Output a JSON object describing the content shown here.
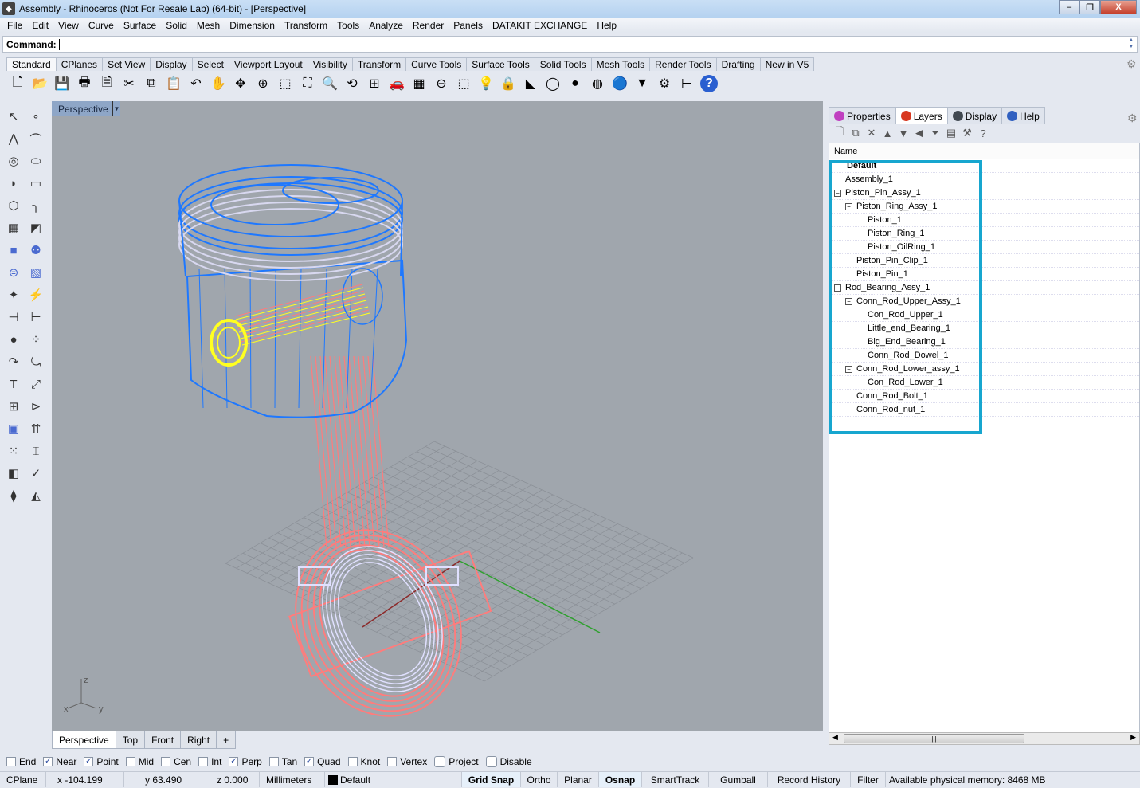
{
  "window": {
    "title": "Assembly - Rhinoceros (Not For Resale Lab) (64-bit) - [Perspective]",
    "minimize": "–",
    "restore": "❐",
    "close": "X"
  },
  "menu": [
    "File",
    "Edit",
    "View",
    "Curve",
    "Surface",
    "Solid",
    "Mesh",
    "Dimension",
    "Transform",
    "Tools",
    "Analyze",
    "Render",
    "Panels",
    "DATAKIT EXCHANGE",
    "Help"
  ],
  "command": {
    "label": "Command:",
    "value": ""
  },
  "toolbar_tabs": [
    "Standard",
    "CPlanes",
    "Set View",
    "Display",
    "Select",
    "Viewport Layout",
    "Visibility",
    "Transform",
    "Curve Tools",
    "Surface Tools",
    "Solid Tools",
    "Mesh Tools",
    "Render Tools",
    "Drafting",
    "New in V5"
  ],
  "toolbar_icons": [
    {
      "name": "new-icon",
      "glyph": "🗋"
    },
    {
      "name": "open-icon",
      "glyph": "📂"
    },
    {
      "name": "save-icon",
      "glyph": "💾"
    },
    {
      "name": "print-icon",
      "glyph": "🖶"
    },
    {
      "name": "export-icon",
      "glyph": "🗎"
    },
    {
      "name": "cut-icon",
      "glyph": "✂"
    },
    {
      "name": "copy-icon",
      "glyph": "⧉"
    },
    {
      "name": "paste-icon",
      "glyph": "📋"
    },
    {
      "name": "undo-icon",
      "glyph": "↶"
    },
    {
      "name": "pan-icon",
      "glyph": "✋"
    },
    {
      "name": "rotate-view-icon",
      "glyph": "✥"
    },
    {
      "name": "zoom-dynamic-icon",
      "glyph": "⊕"
    },
    {
      "name": "zoom-window-icon",
      "glyph": "⬚"
    },
    {
      "name": "zoom-extents-icon",
      "glyph": "⛶"
    },
    {
      "name": "zoom-selected-icon",
      "glyph": "🔍"
    },
    {
      "name": "undo-view-icon",
      "glyph": "⟲"
    },
    {
      "name": "viewport-layout-icon",
      "glyph": "⊞"
    },
    {
      "name": "car-icon",
      "glyph": "🚗"
    },
    {
      "name": "cplane-icon",
      "glyph": "▦"
    },
    {
      "name": "osnap-icon",
      "glyph": "⊖"
    },
    {
      "name": "select-points-icon",
      "glyph": "⬚"
    },
    {
      "name": "light-icon",
      "glyph": "💡"
    },
    {
      "name": "lock-icon",
      "glyph": "🔒"
    },
    {
      "name": "layer-icon",
      "glyph": "◣"
    },
    {
      "name": "color-wheel-icon",
      "glyph": "◯"
    },
    {
      "name": "shaded-sphere-icon",
      "glyph": "●"
    },
    {
      "name": "rendered-sphere-icon",
      "glyph": "◍"
    },
    {
      "name": "render-sphere-icon",
      "glyph": "🔵"
    },
    {
      "name": "cone-icon",
      "glyph": "▼"
    },
    {
      "name": "options-gear-icon",
      "glyph": "⚙"
    },
    {
      "name": "dimension-icon",
      "glyph": "⊢"
    },
    {
      "name": "help-icon",
      "glyph": "?"
    }
  ],
  "left_tools": [
    "select-arrow-icon",
    "point-icon",
    "polyline-icon",
    "curve-icon",
    "circle-icon",
    "ellipse-icon",
    "arc-icon",
    "rectangle-icon",
    "polygon-icon",
    "fillet-icon",
    "surface-points-icon",
    "sweep-icon",
    "box-icon",
    "spheres-icon",
    "cylinder-icon",
    "mesh-icon",
    "join-icon",
    "explode-icon",
    "trim-icon",
    "split-icon",
    "boolean-union-icon",
    "points-icon",
    "offset-icon",
    "offset-curve-icon",
    "text-icon",
    "scale-icon",
    "array-icon",
    "move-icon",
    "solid-box-icon",
    "extrude-icon",
    "grid-array-icon",
    "section-icon",
    "transform-icon",
    "check-icon",
    "solids-icon",
    "analyze-icon"
  ],
  "left_glyphs": [
    "↖",
    "∘",
    "⋀",
    "⌒",
    "◎",
    "⬭",
    "◗",
    "▭",
    "⬡",
    "╮",
    "▦",
    "◩",
    "■",
    "⚉",
    "⊜",
    "▧",
    "✦",
    "⚡",
    "⊣",
    "⊢",
    "●",
    "⁘",
    "↷",
    "⤿",
    "T",
    "⤢",
    "⊞",
    "⊳",
    "▣",
    "⇈",
    "⁙",
    "⌶",
    "◧",
    "✓",
    "⧫",
    "◭"
  ],
  "viewport": {
    "title": "Perspective",
    "axes": {
      "z": "z",
      "x": "x",
      "y": "y"
    },
    "tabs": [
      "Perspective",
      "Top",
      "Front",
      "Right"
    ],
    "add_tab": "+"
  },
  "panel": {
    "tabs": [
      {
        "label": "Properties",
        "color": "#c040c0"
      },
      {
        "label": "Layers",
        "color": "#d83820"
      },
      {
        "label": "Display",
        "color": "#404850"
      },
      {
        "label": "Help",
        "color": "#3060c0"
      }
    ],
    "tools": [
      "🗋",
      "⧉",
      "✕",
      "▲",
      "▼",
      "◀",
      "⏷",
      "▤",
      "⚒",
      "?"
    ],
    "column": "Name",
    "layers": [
      {
        "name": "Default",
        "level": 0,
        "bold": true,
        "expander": false
      },
      {
        "name": "Assembly_1",
        "level": 0,
        "expander": false
      },
      {
        "name": "Piston_Pin_Assy_1",
        "level": 0,
        "expander": true
      },
      {
        "name": "Piston_Ring_Assy_1",
        "level": 1,
        "expander": true
      },
      {
        "name": "Piston_1",
        "level": 2,
        "expander": false
      },
      {
        "name": "Piston_Ring_1",
        "level": 2,
        "expander": false
      },
      {
        "name": "Piston_OilRing_1",
        "level": 2,
        "expander": false
      },
      {
        "name": "Piston_Pin_Clip_1",
        "level": 1,
        "expander": false
      },
      {
        "name": "Piston_Pin_1",
        "level": 1,
        "expander": false
      },
      {
        "name": "Rod_Bearing_Assy_1",
        "level": 0,
        "expander": true
      },
      {
        "name": "Conn_Rod_Upper_Assy_1",
        "level": 1,
        "expander": true
      },
      {
        "name": "Con_Rod_Upper_1",
        "level": 2,
        "expander": false
      },
      {
        "name": "Little_end_Bearing_1",
        "level": 2,
        "expander": false
      },
      {
        "name": "Big_End_Bearing_1",
        "level": 2,
        "expander": false
      },
      {
        "name": "Conn_Rod_Dowel_1",
        "level": 2,
        "expander": false
      },
      {
        "name": "Conn_Rod_Lower_assy_1",
        "level": 1,
        "expander": true
      },
      {
        "name": "Con_Rod_Lower_1",
        "level": 2,
        "expander": false
      },
      {
        "name": "Conn_Rod_Bolt_1",
        "level": 1,
        "expander": false
      },
      {
        "name": "Conn_Rod_nut_1",
        "level": 1,
        "expander": false
      }
    ],
    "highlight_color": "#17a6cf"
  },
  "osnaps": [
    {
      "label": "End",
      "checked": false
    },
    {
      "label": "Near",
      "checked": true
    },
    {
      "label": "Point",
      "checked": true
    },
    {
      "label": "Mid",
      "checked": false
    },
    {
      "label": "Cen",
      "checked": false
    },
    {
      "label": "Int",
      "checked": false
    },
    {
      "label": "Perp",
      "checked": true
    },
    {
      "label": "Tan",
      "checked": false
    },
    {
      "label": "Quad",
      "checked": true
    },
    {
      "label": "Knot",
      "checked": false
    },
    {
      "label": "Vertex",
      "checked": false
    },
    {
      "label": "Project",
      "checked": false,
      "button": true
    },
    {
      "label": "Disable",
      "checked": false,
      "button": true
    }
  ],
  "status": {
    "cplane": "CPlane",
    "x": "x -104.199",
    "y": "y 63.490",
    "z": "z 0.000",
    "units": "Millimeters",
    "layer": "Default",
    "toggles": [
      {
        "label": "Grid Snap",
        "on": true
      },
      {
        "label": "Ortho",
        "on": false
      },
      {
        "label": "Planar",
        "on": false
      },
      {
        "label": "Osnap",
        "on": true
      },
      {
        "label": "SmartTrack",
        "on": false
      },
      {
        "label": "Gumball",
        "on": false
      },
      {
        "label": "Record History",
        "on": false
      },
      {
        "label": "Filter",
        "on": false
      }
    ],
    "memory": "Available physical memory: 8468 MB"
  },
  "colors": {
    "piston": "#1e78ff",
    "rings": "#d8d8f0",
    "pin": "#ffff20",
    "rod": "#ff7c7c",
    "bearing": "#e0e0ff",
    "grid": "#8a8f96",
    "axis_x": "#8c2a2a",
    "axis_y": "#2ea02e"
  }
}
